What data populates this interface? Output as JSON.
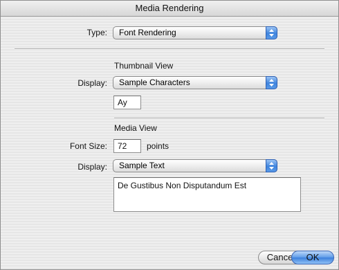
{
  "window": {
    "title": "Media Rendering"
  },
  "type": {
    "label": "Type:",
    "value": "Font Rendering"
  },
  "thumbnail_view": {
    "heading": "Thumbnail View",
    "display_label": "Display:",
    "display_value": "Sample Characters",
    "sample_value": "Ay"
  },
  "media_view": {
    "heading": "Media View",
    "font_size_label": "Font Size:",
    "font_size_value": "72",
    "font_size_unit": "points",
    "display_label": "Display:",
    "display_value": "Sample Text",
    "sample_text": "De Gustibus Non Disputandum Est"
  },
  "buttons": {
    "cancel": "Cancel",
    "ok": "OK"
  }
}
